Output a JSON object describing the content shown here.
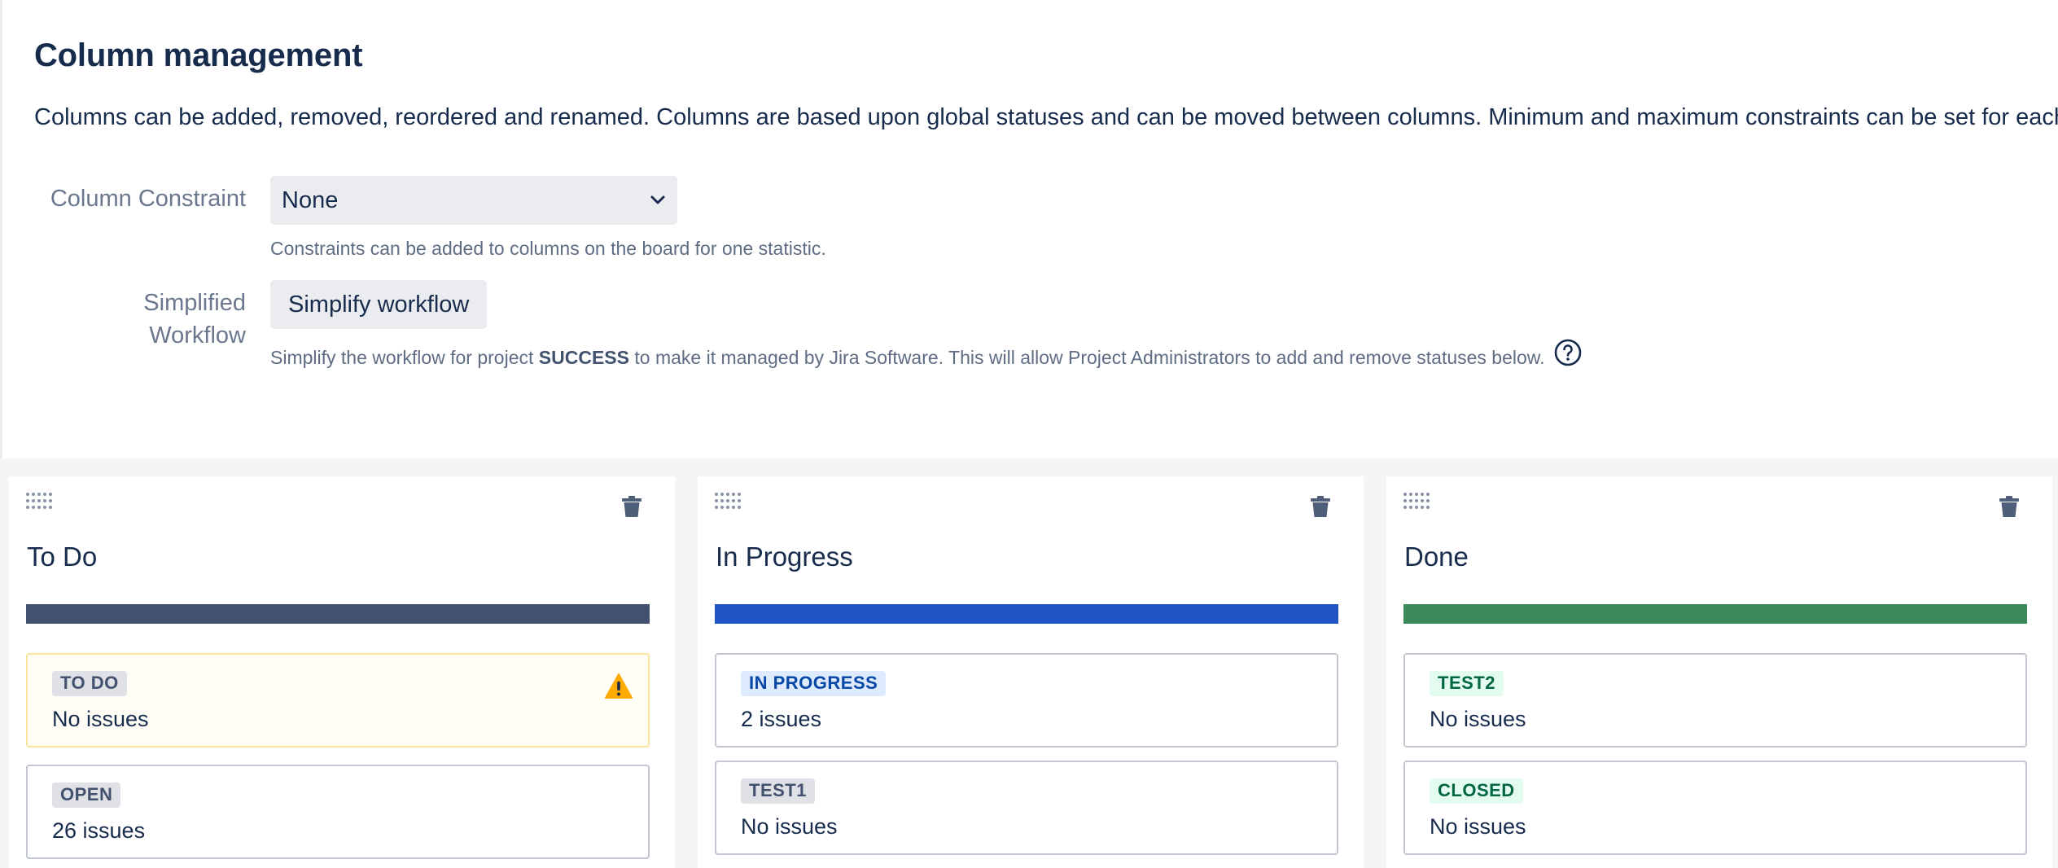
{
  "page": {
    "title": "Column management",
    "description": "Columns can be added, removed, reordered and renamed. Columns are based upon global statuses and can be moved between columns. Minimum and maximum constraints can be set for each"
  },
  "constraint": {
    "label": "Column Constraint",
    "selected": "None",
    "helper": "Constraints can be added to columns on the board for one statistic."
  },
  "workflow": {
    "label": "Simplified Workflow",
    "button_label": "Simplify workflow",
    "helper_before": "Simplify the workflow for project",
    "project": "SUCCESS",
    "helper_after": "to make it managed by Jira Software. This will allow Project Administrators to add and remove statuses below."
  },
  "colors": {
    "todo_bar": "#42526e",
    "in_progress_bar": "#1f54c4",
    "done_bar": "#3c8a5a",
    "warning": "#ffab00"
  },
  "columns": [
    {
      "title": "To Do",
      "statuses": [
        {
          "name": "TO DO",
          "count": "No issues",
          "warning": true
        },
        {
          "name": "OPEN",
          "count": "26 issues"
        }
      ]
    },
    {
      "title": "In Progress",
      "statuses": [
        {
          "name": "IN PROGRESS",
          "count": "2 issues"
        },
        {
          "name": "TEST1",
          "count": "No issues"
        }
      ]
    },
    {
      "title": "Done",
      "statuses": [
        {
          "name": "TEST2",
          "count": "No issues"
        },
        {
          "name": "CLOSED",
          "count": "No issues"
        }
      ]
    }
  ]
}
